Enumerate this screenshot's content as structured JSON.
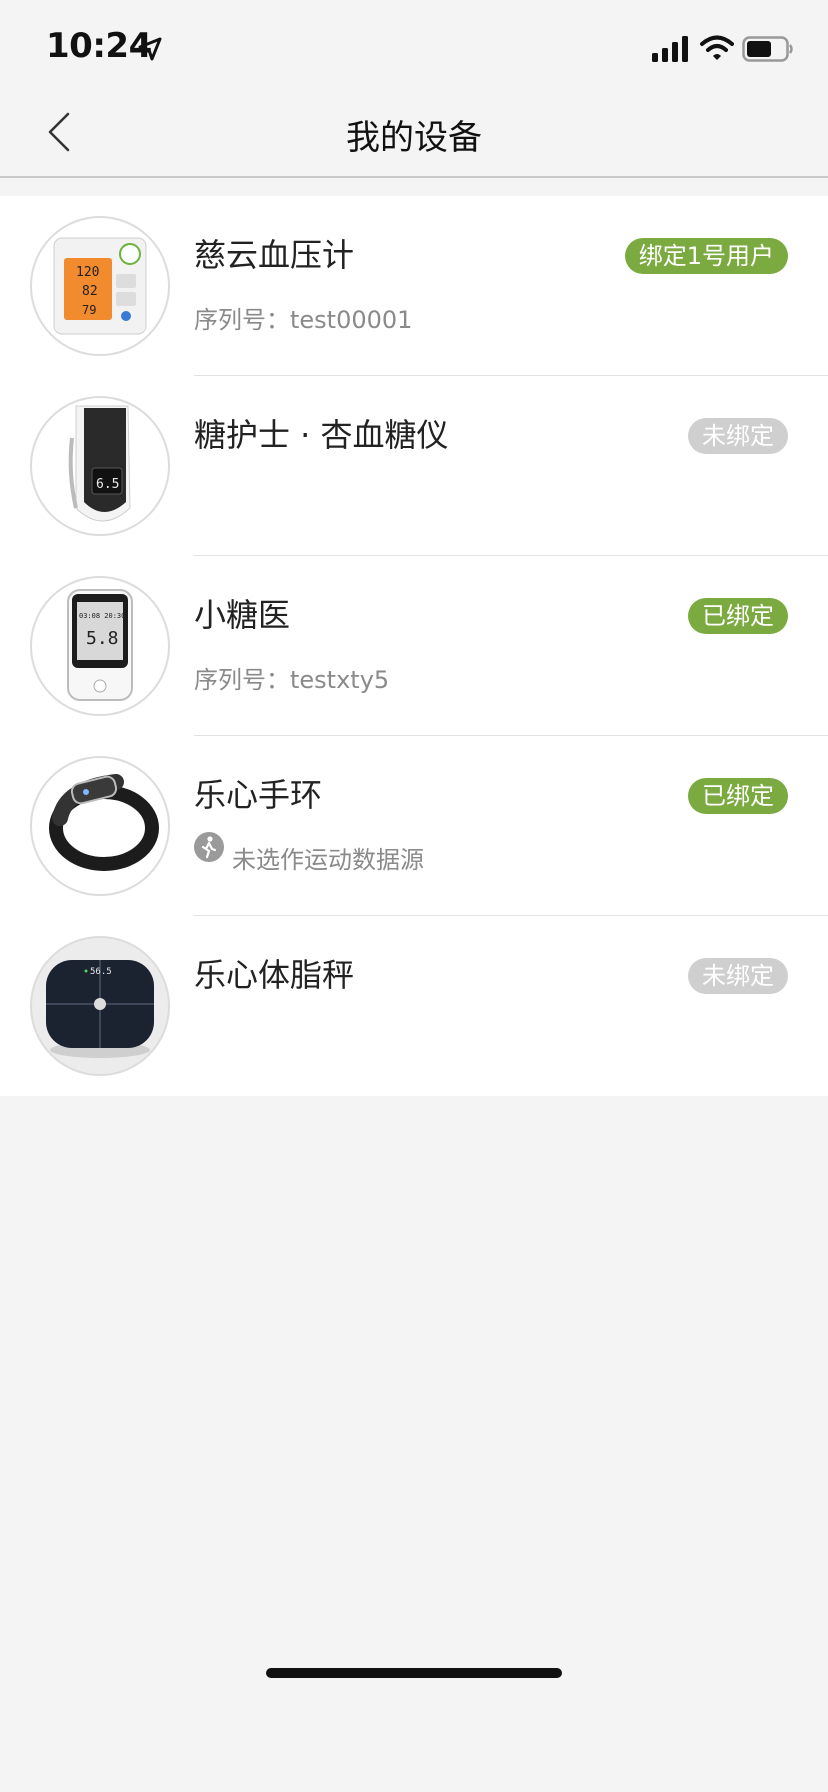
{
  "status_bar": {
    "time": "10:24",
    "location_icon": "location-arrow-icon",
    "signal_icon": "cellular-signal-icon",
    "wifi_icon": "wifi-icon",
    "battery_icon": "battery-icon"
  },
  "nav": {
    "title": "我的设备",
    "back_icon": "chevron-left-icon"
  },
  "colors": {
    "bound_badge": "#7bab40",
    "unbound_badge": "#cfcfcf",
    "background": "#f4f4f4"
  },
  "devices": [
    {
      "name": "慈云血压计",
      "badge": "绑定1号用户",
      "badge_state": "bound",
      "sub": "序列号：test00001",
      "image": "blood-pressure-monitor"
    },
    {
      "name": "糖护士 · 杏血糖仪",
      "badge": "未绑定",
      "badge_state": "unbound",
      "sub": "",
      "image": "glucose-meter-pen"
    },
    {
      "name": "小糖医",
      "badge": "已绑定",
      "badge_state": "bound",
      "sub": "序列号：testxty5",
      "image": "glucose-meter-handheld"
    },
    {
      "name": "乐心手环",
      "badge": "已绑定",
      "badge_state": "bound",
      "sub": "未选作运动数据源",
      "sub_icon": "walking-person-icon",
      "image": "fitness-band"
    },
    {
      "name": "乐心体脂秤",
      "badge": "未绑定",
      "badge_state": "unbound",
      "sub": "",
      "image": "body-fat-scale"
    }
  ],
  "device_screens": {
    "bp_values": [
      "120",
      "82",
      "79"
    ],
    "glucose_pen_value": "6.5",
    "glucose_handheld_value": "5.8",
    "glucose_handheld_time": "03:08 20:30",
    "scale_value": "56.5"
  }
}
